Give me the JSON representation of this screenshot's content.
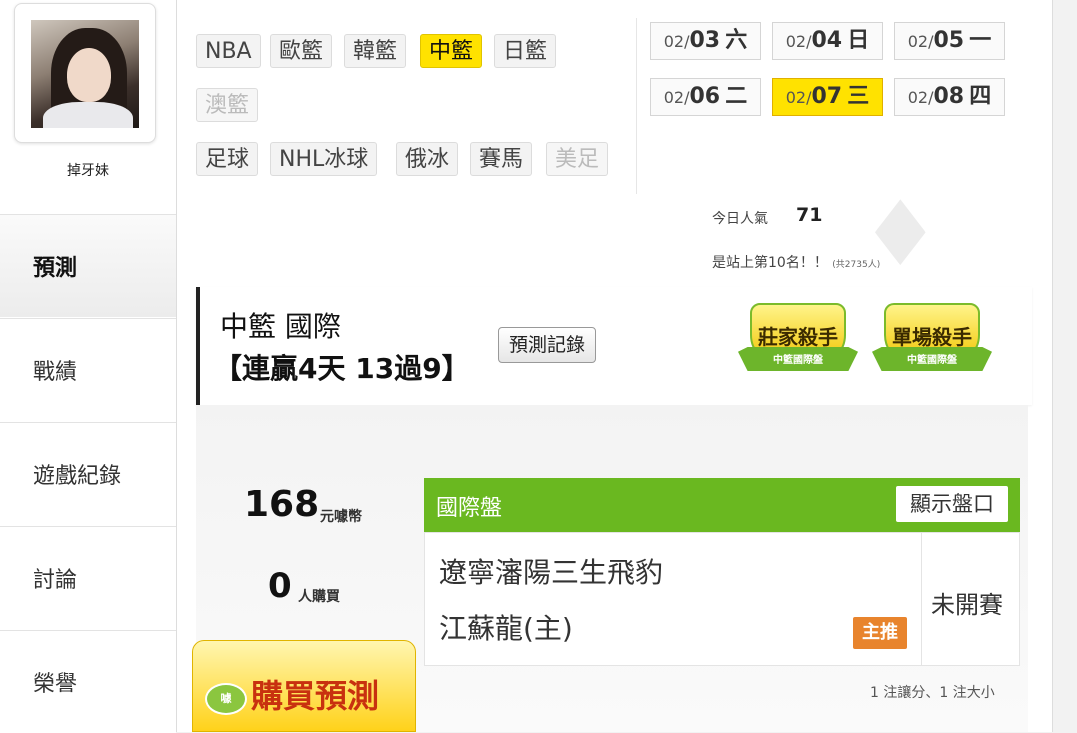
{
  "user": {
    "name": "掉牙妹"
  },
  "menu": [
    {
      "label": "預測",
      "active": true
    },
    {
      "label": "戰績"
    },
    {
      "label": "遊戲紀錄"
    },
    {
      "label": "討論"
    },
    {
      "label": "榮譽"
    }
  ],
  "leagues": [
    {
      "label": "NBA"
    },
    {
      "label": "歐籃"
    },
    {
      "label": "韓籃"
    },
    {
      "label": "中籃",
      "selected": true
    },
    {
      "label": "日籃"
    },
    {
      "label": "澳籃",
      "disabled": true
    },
    {
      "label": "足球"
    },
    {
      "label": "NHL冰球"
    },
    {
      "label": "俄冰"
    },
    {
      "label": "賽馬"
    },
    {
      "label": "美足",
      "disabled": true
    }
  ],
  "dates": [
    {
      "md": "02/",
      "day": "03",
      "wd": "六"
    },
    {
      "md": "02/",
      "day": "04",
      "wd": "日"
    },
    {
      "md": "02/",
      "day": "05",
      "wd": "一"
    },
    {
      "md": "02/",
      "day": "06",
      "wd": "二"
    },
    {
      "md": "02/",
      "day": "07",
      "wd": "三",
      "selected": true
    },
    {
      "md": "02/",
      "day": "08",
      "wd": "四"
    }
  ],
  "popularity": {
    "label": "今日人氣",
    "value": "71",
    "rank_text": "是站上第10名！！",
    "rank_total": "(共2735人)"
  },
  "header": {
    "league_title": "中籃 國際",
    "streak": "【連贏4天 13過9】",
    "record_button": "預測記錄"
  },
  "badges": [
    {
      "title": "莊家殺手",
      "sub": "中籃國際盤"
    },
    {
      "title": "單場殺手",
      "sub": "中籃國際盤"
    }
  ],
  "sale": {
    "price": "168",
    "price_unit": "元噱幣",
    "buyers": "0",
    "buyers_unit": "人購買",
    "buy_button": "購買預測",
    "coin_label": "噱"
  },
  "odds": {
    "title": "國際盤",
    "show_button": "顯示盤口",
    "team_away": "遼寧瀋陽三生飛豹",
    "team_home": "江蘇龍(主)",
    "pick_tag": "主推",
    "status": "未開賽",
    "summary": "1 注讓分、1 注大小"
  },
  "colors": {
    "accent": "#ffe200",
    "green": "#6ab820",
    "orange": "#e8842d"
  }
}
